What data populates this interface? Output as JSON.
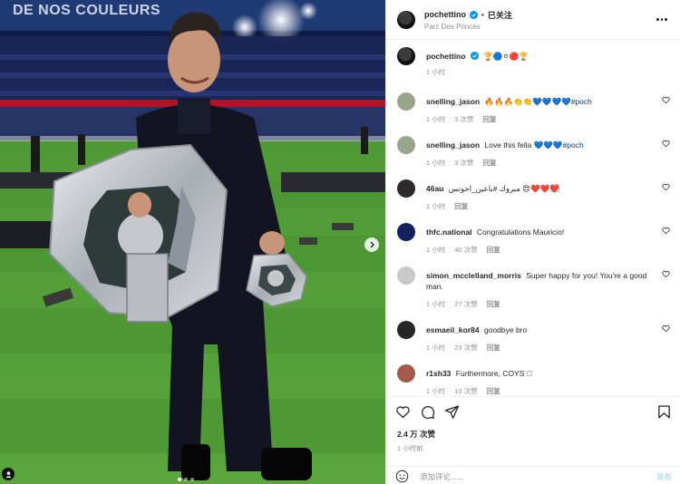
{
  "photo": {
    "banner_text": "DE NOS COULEURS",
    "next_icon": "chevron-right-icon",
    "carousel_count": 3,
    "carousel_active": 1
  },
  "header": {
    "username": "pochettino",
    "separator": "•",
    "follow_label": "已关注",
    "location": "Parc Des Princes"
  },
  "caption": {
    "username": "pochettino",
    "text": "🏆🔵⚪🔴🏆",
    "time": "1 小时"
  },
  "comments": [
    {
      "username": "snelling_jason",
      "text": "🔥🔥🔥👏👏💙💙💙💙",
      "hashtag": "#poch",
      "time": "1 小时",
      "likes": "3 次赞",
      "reply": "回复",
      "avatar_color": "#9aa58a"
    },
    {
      "username": "snelling_jason",
      "text": "Love this fella 💙💙💙",
      "hashtag": "#poch",
      "time": "1 小时",
      "likes": "3 次赞",
      "reply": "回复",
      "avatar_color": "#9aa58a"
    },
    {
      "username": "46au",
      "text": "مبروك #باعين_اخوتس 😍❤️❤️❤️⃞",
      "hashtag": "",
      "time": "1 小时",
      "likes": "",
      "reply": "回复",
      "avatar_color": "#2d2b2b"
    },
    {
      "username": "thfc.national",
      "text": "Congratulations Mauricio!",
      "hashtag": "",
      "time": "1 小时",
      "likes": "40 次赞",
      "reply": "回复",
      "avatar_color": "#13225a"
    },
    {
      "username": "simon_mcclelland_morris",
      "text": "Super happy for you! You're a good man.",
      "hashtag": "",
      "time": "1 小时",
      "likes": "27 次赞",
      "reply": "回复",
      "avatar_color": "#c9c9c9"
    },
    {
      "username": "esmaeil_kor84",
      "text": "goodbye bro",
      "hashtag": "",
      "time": "1 小时",
      "likes": "23 次赞",
      "reply": "回复",
      "avatar_color": "#262626"
    },
    {
      "username": "r1sh33",
      "text": "Furthermore, COYS ⃞",
      "hashtag": "",
      "time": "1 小时",
      "likes": "10 次赞",
      "reply": "回复",
      "avatar_color": "#a25a4a"
    }
  ],
  "actions": {
    "like_icon": "heart-icon",
    "comment_icon": "comment-icon",
    "share_icon": "send-icon",
    "save_icon": "bookmark-icon",
    "likes_count": "2.4 万 次赞",
    "post_time": "1 小时前"
  },
  "add_comment": {
    "placeholder": "添加评论......",
    "post_label": "发布",
    "emoji_icon": "smiley-icon"
  },
  "colors": {
    "text": "#262626",
    "secondary": "#8e8e8e",
    "link": "#00376b",
    "verified": "#0095f6",
    "post_disabled": "#b2dffc",
    "border": "#efefef"
  }
}
